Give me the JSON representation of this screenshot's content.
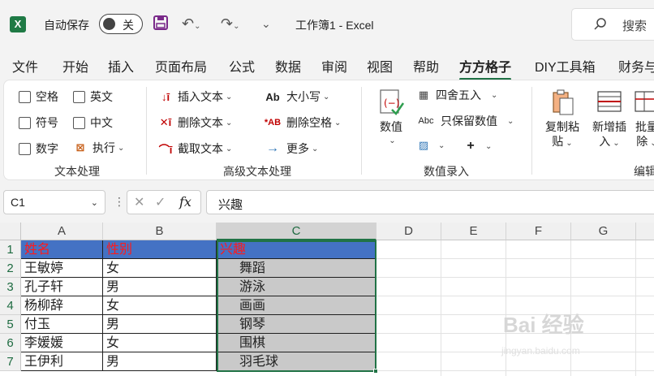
{
  "titlebar": {
    "app_icon": "X",
    "autosave_label": "自动保存",
    "autosave_state": "关",
    "doc_title": "工作簿1  -  Excel",
    "search_placeholder": "搜索"
  },
  "tabs": [
    "文件",
    "开始",
    "插入",
    "页面布局",
    "公式",
    "数据",
    "审阅",
    "视图",
    "帮助",
    "方方格子",
    "DIY工具箱",
    "财务与"
  ],
  "active_tab": "方方格子",
  "ribbon": {
    "text_group": {
      "label": "文本处理",
      "options": [
        "空格",
        "英文",
        "符号",
        "中文",
        "数字"
      ],
      "execute": "执行"
    },
    "adv_group": {
      "label": "高级文本处理",
      "insert_text": "插入文本",
      "delete_text": "删除文本",
      "extract_text": "截取文本",
      "case": "大小写",
      "delete_space": "删除空格",
      "more": "更多"
    },
    "num_group": {
      "label": "数值录入",
      "value": "数值",
      "round": "四舍五入",
      "keep_value": "只保留数值"
    },
    "edit_group": {
      "label": "编辑",
      "copy_paste": [
        "复制粘",
        "贴"
      ],
      "insert_new": [
        "新增插",
        "入"
      ],
      "batch_delete": [
        "批量",
        "除"
      ]
    }
  },
  "formula_bar": {
    "name_box": "C1",
    "fx": "fx",
    "value": "兴趣"
  },
  "sheet": {
    "columns": [
      "A",
      "B",
      "C",
      "D",
      "E",
      "F",
      "G"
    ],
    "rows": [
      "1",
      "2",
      "3",
      "4",
      "5",
      "6",
      "7"
    ],
    "header": [
      "姓名",
      "性别",
      "兴趣"
    ],
    "data": [
      [
        "王敏婷",
        "女",
        "舞蹈"
      ],
      [
        "孔子轩",
        "男",
        "游泳"
      ],
      [
        "杨柳辞",
        "女",
        "画画"
      ],
      [
        "付玉",
        "男",
        "钢琴"
      ],
      [
        "李媛媛",
        "女",
        "围棋"
      ],
      [
        "王伊利",
        "男",
        "羽毛球"
      ]
    ]
  },
  "watermark": {
    "text": "Bai 经验",
    "sub": "jingyan.baidu.com"
  }
}
